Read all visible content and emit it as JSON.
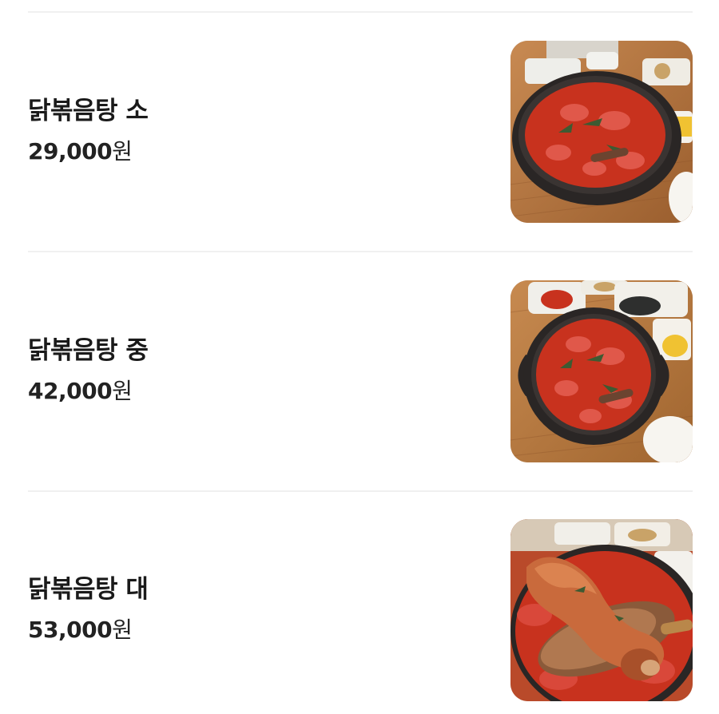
{
  "menu": {
    "items": [
      {
        "name": "닭볶음탕 소",
        "price": "29,000",
        "currency": "원",
        "photo": "braised spicy chicken in black pot"
      },
      {
        "name": "닭볶음탕 중",
        "price": "42,000",
        "currency": "원",
        "photo": "braised spicy chicken with side dishes"
      },
      {
        "name": "닭볶음탕 대",
        "price": "53,000",
        "currency": "원",
        "photo": "chicken drumstick lifted on ladle"
      }
    ]
  },
  "colors": {
    "divider": "#f0f0f0",
    "text": "#1a1a1a",
    "stew": "#c8321e",
    "table": "#b7773f"
  }
}
